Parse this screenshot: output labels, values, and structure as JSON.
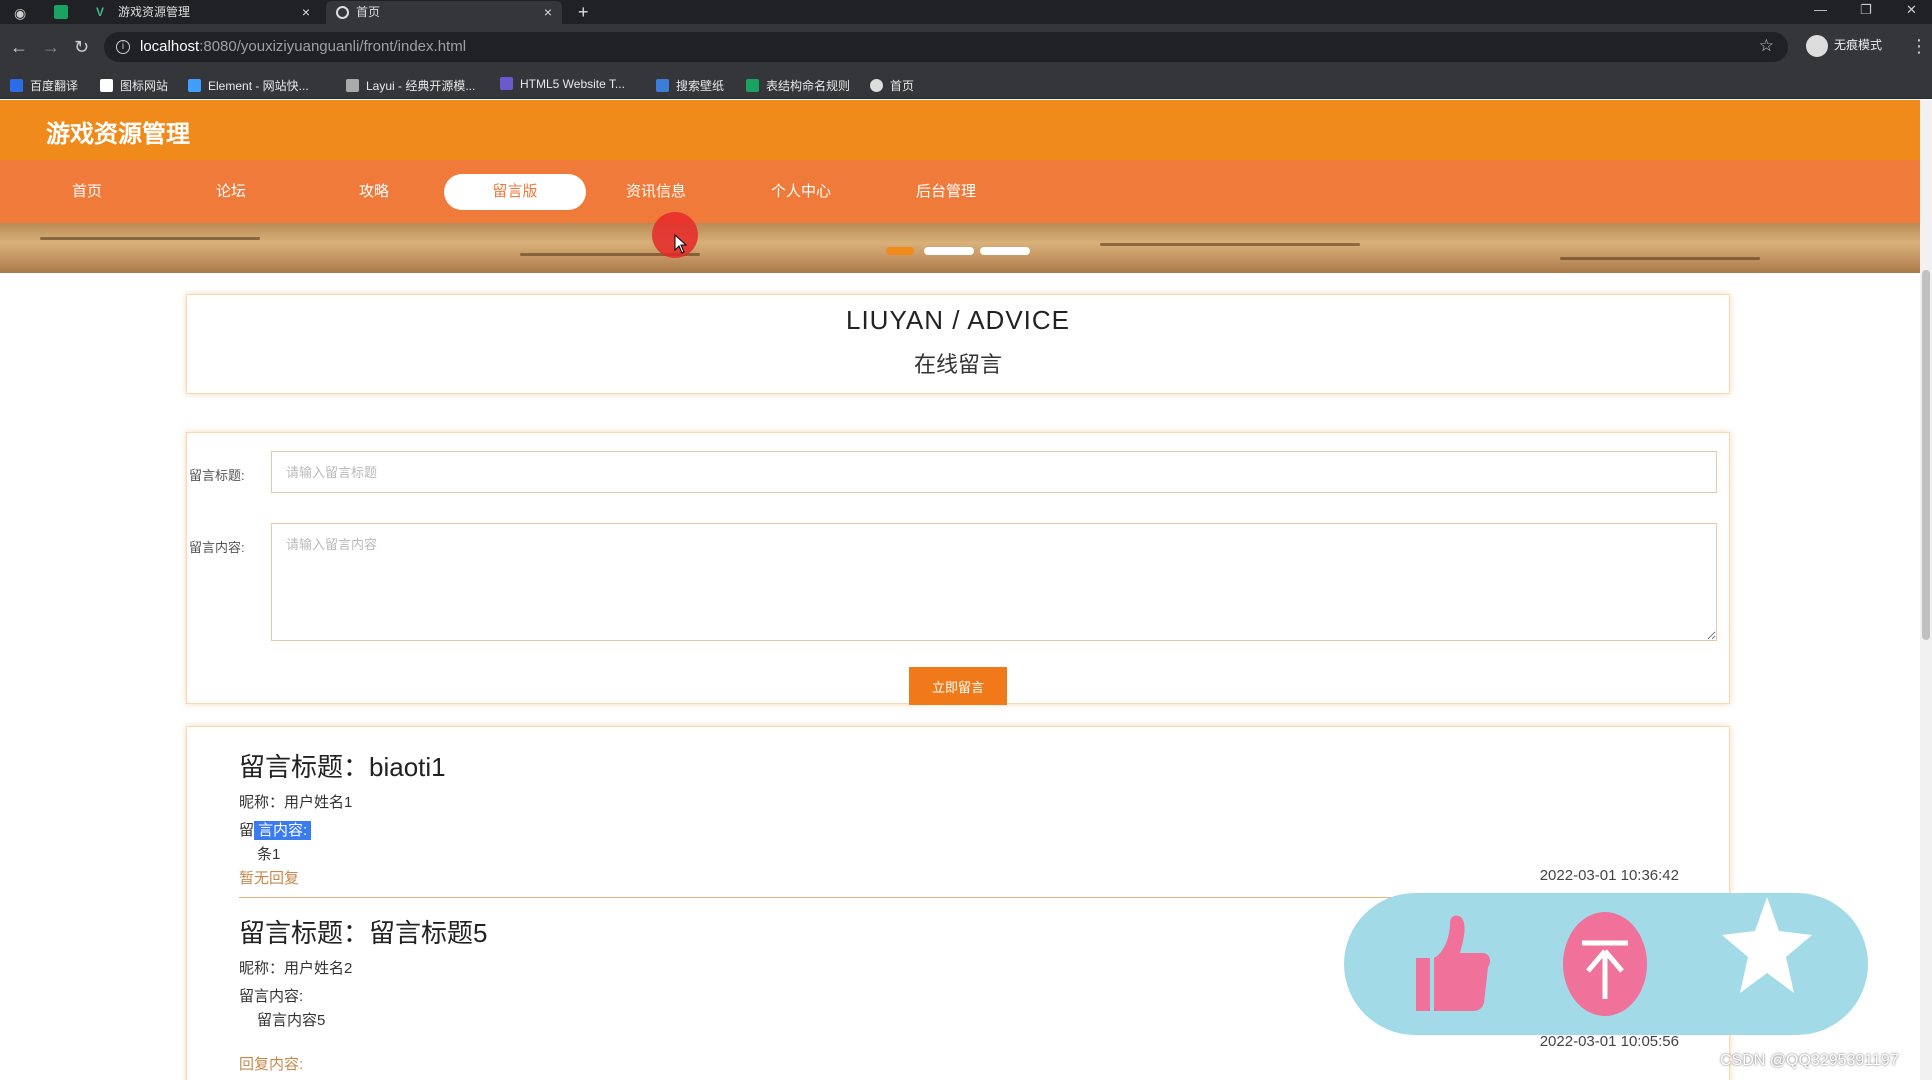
{
  "browser": {
    "tabs": [
      {
        "label": "游戏资源管理",
        "close": "×"
      },
      {
        "label": "首页",
        "close": "×"
      }
    ],
    "new_tab": "+",
    "window_controls": {
      "minimize": "—",
      "restore": "❐",
      "close": "✕"
    },
    "nav": {
      "back": "←",
      "forward": "→",
      "reload": "↻"
    },
    "url_host": "localhost",
    "url_rest": ":8080/youxiziyuanguanli/front/index.html",
    "star": "☆",
    "incognito_label": "无痕模式",
    "menu": "⋮",
    "bookmarks": [
      {
        "label": "百度翻译",
        "color": "#2b6de8"
      },
      {
        "label": "图标网站",
        "color": "#ffffff"
      },
      {
        "label": "Element - 网站快...",
        "color": "#409eff"
      },
      {
        "label": "Layui - 经典开源模...",
        "color": "#aaaaaa"
      },
      {
        "label": "HTML5 Website T...",
        "color": "#6a5acd"
      },
      {
        "label": "搜索壁纸",
        "color": "#3b7dd8"
      },
      {
        "label": "表结构命名规则",
        "color": "#1aa260"
      },
      {
        "label": "首页",
        "color": "#dddddd"
      }
    ]
  },
  "site": {
    "title": "游戏资源管理",
    "nav": [
      "首页",
      "论坛",
      "攻略",
      "留言版",
      "资讯信息",
      "个人中心",
      "后台管理"
    ],
    "active_nav_index": 3,
    "accent_color": "#f08a1a"
  },
  "heading": {
    "en": "LIUYAN / ADVICE",
    "cn": "在线留言"
  },
  "form": {
    "title_label": "留言标题:",
    "title_placeholder": "请输入留言标题",
    "content_label": "留言内容:",
    "content_placeholder": "请输入留言内容",
    "submit_label": "立即留言"
  },
  "messages": [
    {
      "title": "留言标题：biaoti1",
      "nickname": "昵称：用户姓名1",
      "content_label_first": "留",
      "content_label_rest": "言内容:",
      "content": "条1",
      "reply": "暂无回复",
      "time": "2022-03-01 10:36:42"
    },
    {
      "title": "留言标题：留言标题5",
      "nickname": "昵称：用户姓名2",
      "content_label": "留言内容:",
      "content": "留言内容5",
      "reply": "回复内容:",
      "time": "2022-03-01 10:05:56"
    }
  ],
  "overlay_icons": [
    "thumbs-up-icon",
    "coin-icon",
    "star-icon"
  ],
  "watermark": "CSDN @QQ3295391197"
}
